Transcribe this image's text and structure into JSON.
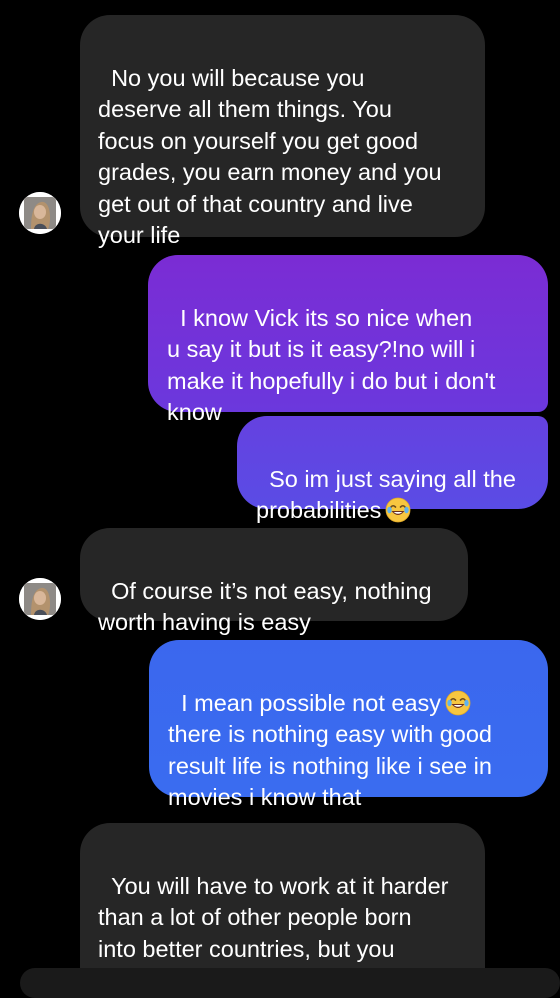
{
  "conversation": {
    "messages": [
      {
        "sender": "them",
        "text": "No you will because you\ndeserve all them things. You\nfocus on yourself you get good\ngrades, you earn money and you\nget out of that country and live\nyour life"
      },
      {
        "sender": "me",
        "text": "I know Vick its so nice when\nu say it but is it easy?!no will i\nmake it hopefully i do but i don't\nknow"
      },
      {
        "sender": "me",
        "text": "So im just saying all the\nprobabilities",
        "emoji": "joy-emoji"
      },
      {
        "sender": "them",
        "text": "Of course it’s not easy, nothing\nworth having is easy"
      },
      {
        "sender": "me",
        "text_line1": "I mean possible not easy",
        "emoji": "joy-emoji",
        "text_rest": "\nthere is nothing easy with good\nresult life is nothing like i see in\nmovies i know that"
      },
      {
        "sender": "them",
        "text": "You will have to work at it harder\nthan a lot of other people born\ninto better countries, but you\nwill make it. I believe you will."
      }
    ]
  },
  "colors": {
    "background": "#000000",
    "incoming_bubble": "#262626",
    "outgoing_top": "#7b2cd4",
    "outgoing_bottom": "#3a6cf0",
    "text": "#ffffff"
  }
}
